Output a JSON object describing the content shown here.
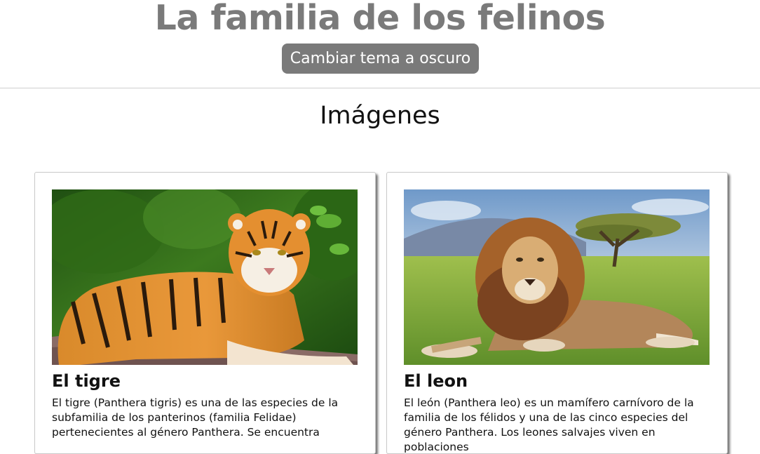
{
  "header": {
    "title": "La familia de los felinos",
    "theme_button_label": "Cambiar tema a oscuro"
  },
  "section": {
    "title": "Imágenes"
  },
  "cards": [
    {
      "title": "El tigre",
      "image": "tiger-photo",
      "text": "El tigre (Panthera tigris) es una de las especies de la subfamilia de los panterinos (familia Felidae) pertenecientes al género Panthera. Se encuentra"
    },
    {
      "title": "El leon",
      "image": "lion-photo",
      "text": "El león (Panthera leo) es un mamífero carnívoro de la familia de los félidos y una de las cinco especies del género Panthera. Los leones salvajes viven en poblaciones"
    }
  ]
}
